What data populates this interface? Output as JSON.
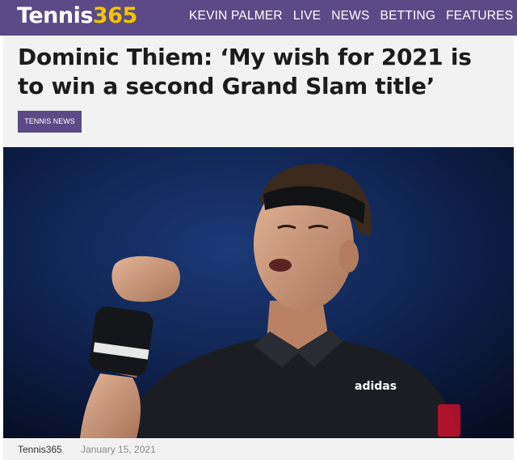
{
  "header": {
    "logo_main": "Tennis",
    "logo_num": "365",
    "nav": [
      "KEVIN PALMER",
      "LIVE",
      "NEWS",
      "BETTING",
      "FEATURES"
    ]
  },
  "article": {
    "headline": "Dominic Thiem: ‘My wish for 2021 is to win a second Grand Slam title’",
    "category": "TENNIS NEWS",
    "author": "Tennis365",
    "date": "January 15, 2021"
  },
  "photo": {
    "shirt_brand": "adidas"
  },
  "colors": {
    "brand_purple": "#5b4a86",
    "logo_accent": "#f5c400"
  }
}
